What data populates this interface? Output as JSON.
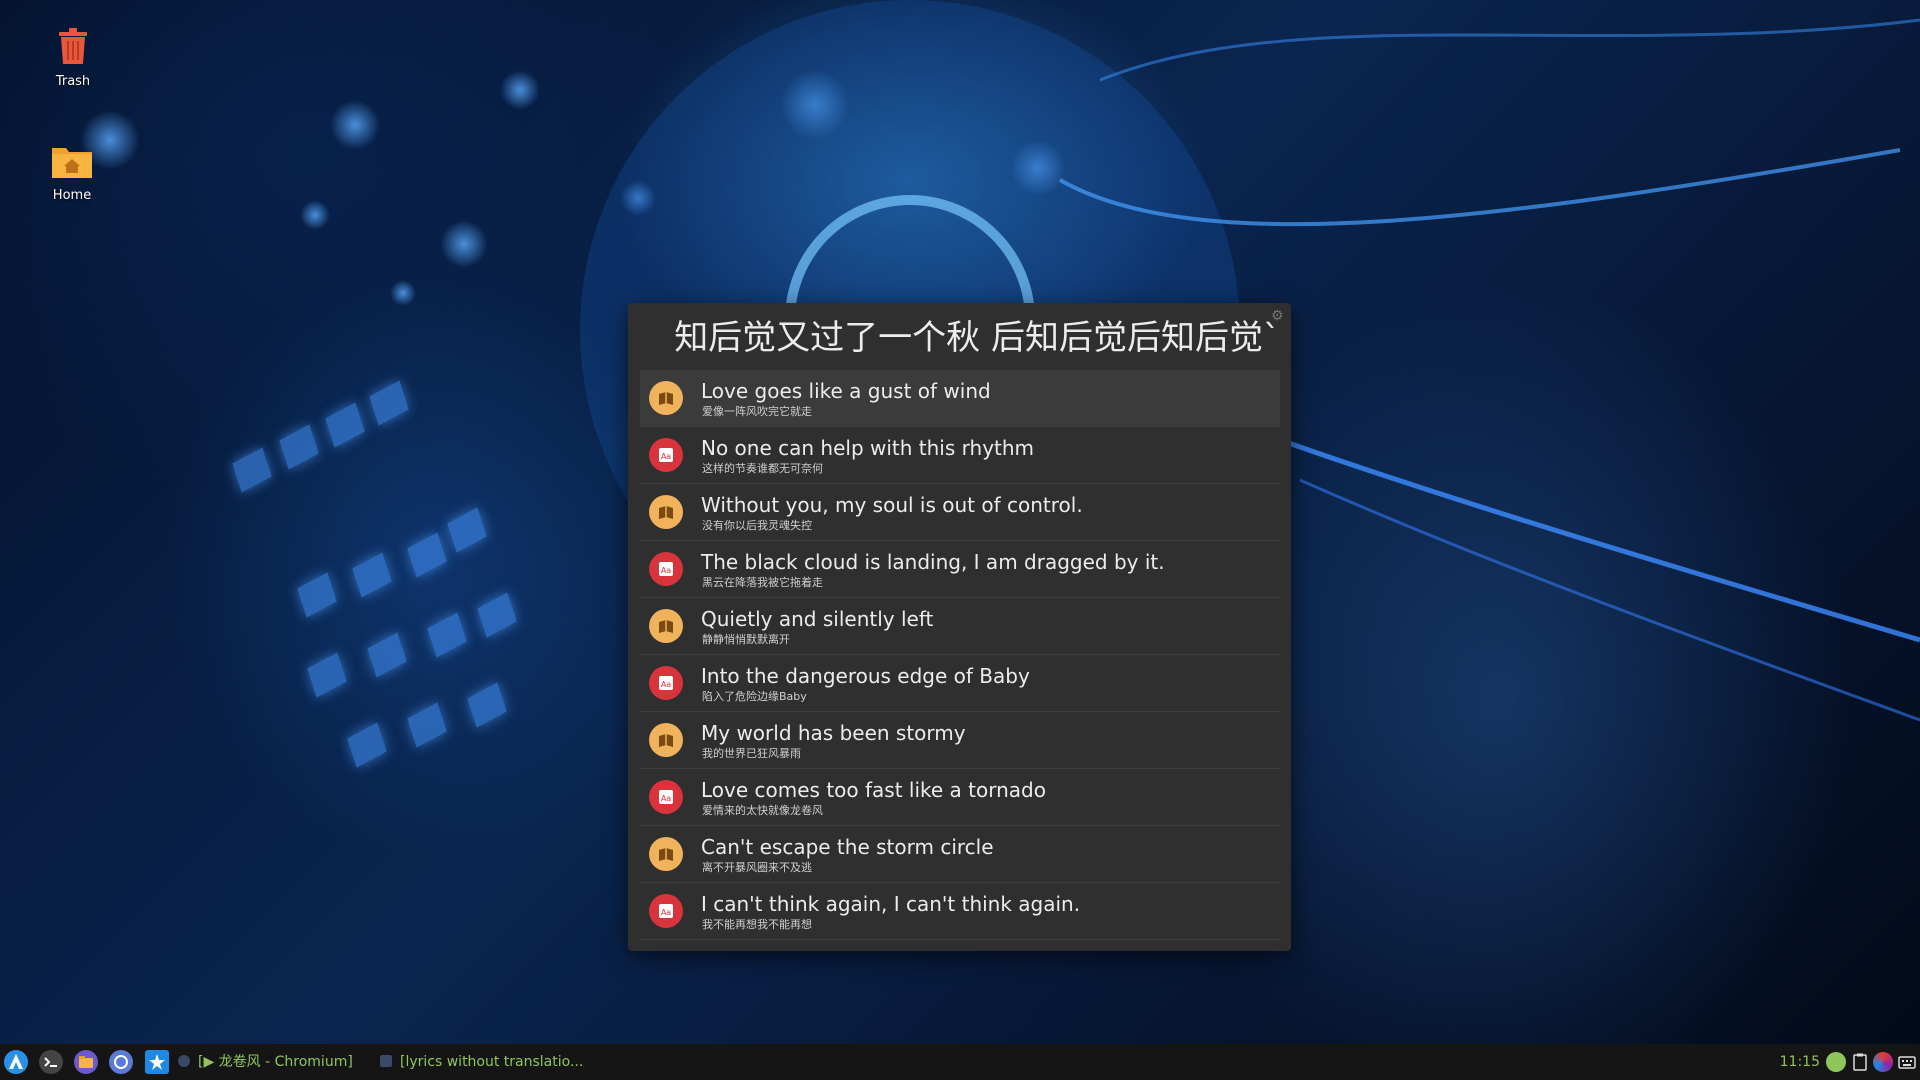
{
  "desktop": {
    "icons": [
      {
        "label": "Trash",
        "icon": "trash-icon"
      },
      {
        "label": "Home",
        "icon": "home-folder-icon"
      }
    ]
  },
  "lyrics_window": {
    "search_text": "知后觉又过了一个秋 后知后觉后知后觉`",
    "settings_icon": "gear-icon",
    "results": [
      {
        "title": "Love goes like a gust of wind",
        "subtitle": "爱像一阵风吹完它就走",
        "icon": "book-icon",
        "selected": true
      },
      {
        "title": "No one can help with this rhythm",
        "subtitle": "这样的节奏谁都无可奈何",
        "icon": "dictionary-icon"
      },
      {
        "title": "Without you, my soul is out of control.",
        "subtitle": "没有你以后我灵魂失控",
        "icon": "book-icon"
      },
      {
        "title": "The black cloud is landing, I am dragged by it.",
        "subtitle": "黑云在降落我被它拖着走",
        "icon": "dictionary-icon"
      },
      {
        "title": "Quietly and silently left",
        "subtitle": "静静悄悄默默离开",
        "icon": "book-icon"
      },
      {
        "title": "Into the dangerous edge of Baby",
        "subtitle": "陷入了危险边缘Baby",
        "icon": "dictionary-icon"
      },
      {
        "title": "My world has been stormy",
        "subtitle": "我的世界已狂风暴雨",
        "icon": "book-icon"
      },
      {
        "title": "Love comes too fast like a tornado",
        "subtitle": "爱情来的太快就像龙卷风",
        "icon": "dictionary-icon"
      },
      {
        "title": "Can't escape the storm circle",
        "subtitle": "离不开暴风圈来不及逃",
        "icon": "book-icon"
      },
      {
        "title": "I can't think again, I can't think again.",
        "subtitle": "我不能再想我不能再想",
        "icon": "dictionary-icon"
      }
    ]
  },
  "taskbar": {
    "launchers": [
      "app-menu-icon",
      "terminal-icon",
      "file-manager-icon",
      "chromium-icon",
      "settings-app-icon"
    ],
    "tasks": [
      {
        "label": "[▶ 龙卷风 - Chromium]",
        "icon": "chromium-task-icon"
      },
      {
        "label": "[lyrics without translatio...",
        "icon": "lyrics-task-icon"
      }
    ],
    "clock": "11:15",
    "tray": [
      "network-icon",
      "clipboard-icon",
      "color-app-icon",
      "keyboard-icon"
    ]
  },
  "colors": {
    "window_bg": "#2f2f2f",
    "book_badge": "#f0b25a",
    "dict_badge": "#d9333c",
    "taskbar_text": "#8ec65a"
  }
}
